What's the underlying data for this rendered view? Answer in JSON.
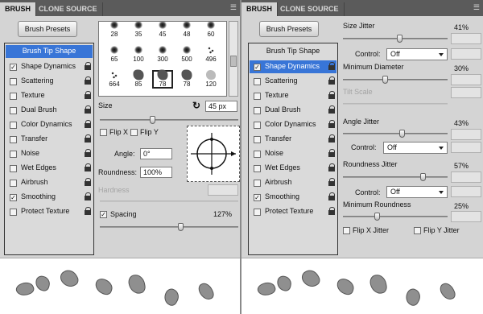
{
  "left_panel": {
    "tabs": [
      "BRUSH",
      "CLONE SOURCE"
    ],
    "presets_button": "Brush Presets",
    "options": [
      {
        "label": "Brush Tip Shape",
        "checked": null,
        "selected": true,
        "lock": false
      },
      {
        "label": "Shape Dynamics",
        "checked": true,
        "selected": false,
        "lock": true
      },
      {
        "label": "Scattering",
        "checked": false,
        "selected": false,
        "lock": true
      },
      {
        "label": "Texture",
        "checked": false,
        "selected": false,
        "lock": true
      },
      {
        "label": "Dual Brush",
        "checked": false,
        "selected": false,
        "lock": true
      },
      {
        "label": "Color Dynamics",
        "checked": false,
        "selected": false,
        "lock": true
      },
      {
        "label": "Transfer",
        "checked": false,
        "selected": false,
        "lock": true
      },
      {
        "label": "Noise",
        "checked": false,
        "selected": false,
        "lock": true
      },
      {
        "label": "Wet Edges",
        "checked": false,
        "selected": false,
        "lock": true
      },
      {
        "label": "Airbrush",
        "checked": false,
        "selected": false,
        "lock": true
      },
      {
        "label": "Smoothing",
        "checked": true,
        "selected": false,
        "lock": true
      },
      {
        "label": "Protect Texture",
        "checked": false,
        "selected": false,
        "lock": true
      }
    ],
    "brush_tips": [
      {
        "size": "28",
        "kind": "soft"
      },
      {
        "size": "35",
        "kind": "soft"
      },
      {
        "size": "45",
        "kind": "soft"
      },
      {
        "size": "48",
        "kind": "soft"
      },
      {
        "size": "60",
        "kind": "soft"
      },
      {
        "size": "65",
        "kind": "soft"
      },
      {
        "size": "100",
        "kind": "soft"
      },
      {
        "size": "300",
        "kind": "soft"
      },
      {
        "size": "500",
        "kind": "soft"
      },
      {
        "size": "496",
        "kind": "speckle"
      },
      {
        "size": "664",
        "kind": "speckle"
      },
      {
        "size": "85",
        "kind": "rock"
      },
      {
        "size": "78",
        "kind": "rock"
      },
      {
        "size": "78",
        "kind": "rock"
      },
      {
        "size": "120",
        "kind": "pale"
      }
    ],
    "selected_tip_index": 12,
    "size_label": "Size",
    "size_value": "45 px",
    "flip_x": "Flip X",
    "flip_y": "Flip Y",
    "angle_label": "Angle:",
    "angle_value": "0°",
    "roundness_label": "Roundness:",
    "roundness_value": "100%",
    "hardness_label": "Hardness",
    "spacing_label": "Spacing",
    "spacing_checked": true,
    "spacing_value": "127%"
  },
  "right_panel": {
    "tabs": [
      "BRUSH",
      "CLONE SOURCE"
    ],
    "presets_button": "Brush Presets",
    "options": [
      {
        "label": "Brush Tip Shape",
        "checked": null,
        "selected": false,
        "lock": false
      },
      {
        "label": "Shape Dynamics",
        "checked": true,
        "selected": true,
        "lock": true
      },
      {
        "label": "Scattering",
        "checked": false,
        "selected": false,
        "lock": true
      },
      {
        "label": "Texture",
        "checked": false,
        "selected": false,
        "lock": true
      },
      {
        "label": "Dual Brush",
        "checked": false,
        "selected": false,
        "lock": true
      },
      {
        "label": "Color Dynamics",
        "checked": false,
        "selected": false,
        "lock": true
      },
      {
        "label": "Transfer",
        "checked": false,
        "selected": false,
        "lock": true
      },
      {
        "label": "Noise",
        "checked": false,
        "selected": false,
        "lock": true
      },
      {
        "label": "Wet Edges",
        "checked": false,
        "selected": false,
        "lock": true
      },
      {
        "label": "Airbrush",
        "checked": false,
        "selected": false,
        "lock": true
      },
      {
        "label": "Smoothing",
        "checked": true,
        "selected": false,
        "lock": true
      },
      {
        "label": "Protect Texture",
        "checked": false,
        "selected": false,
        "lock": true
      }
    ],
    "size_jitter_label": "Size Jitter",
    "size_jitter_value": "41%",
    "control_label": "Control:",
    "control_value_1": "Off",
    "min_diameter_label": "Minimum Diameter",
    "min_diameter_value": "30%",
    "tilt_scale_label": "Tilt Scale",
    "angle_jitter_label": "Angle Jitter",
    "angle_jitter_value": "43%",
    "control_value_2": "Off",
    "roundness_jitter_label": "Roundness Jitter",
    "roundness_jitter_value": "57%",
    "control_value_3": "Off",
    "min_roundness_label": "Minimum Roundness",
    "min_roundness_value": "25%",
    "flip_x_jitter": "Flip X Jitter",
    "flip_y_jitter": "Flip Y Jitter"
  },
  "colors": {
    "selection_blue": "#3875d7",
    "panel_grey": "#d4d4d4",
    "tab_bar": "#5b5b5b"
  }
}
